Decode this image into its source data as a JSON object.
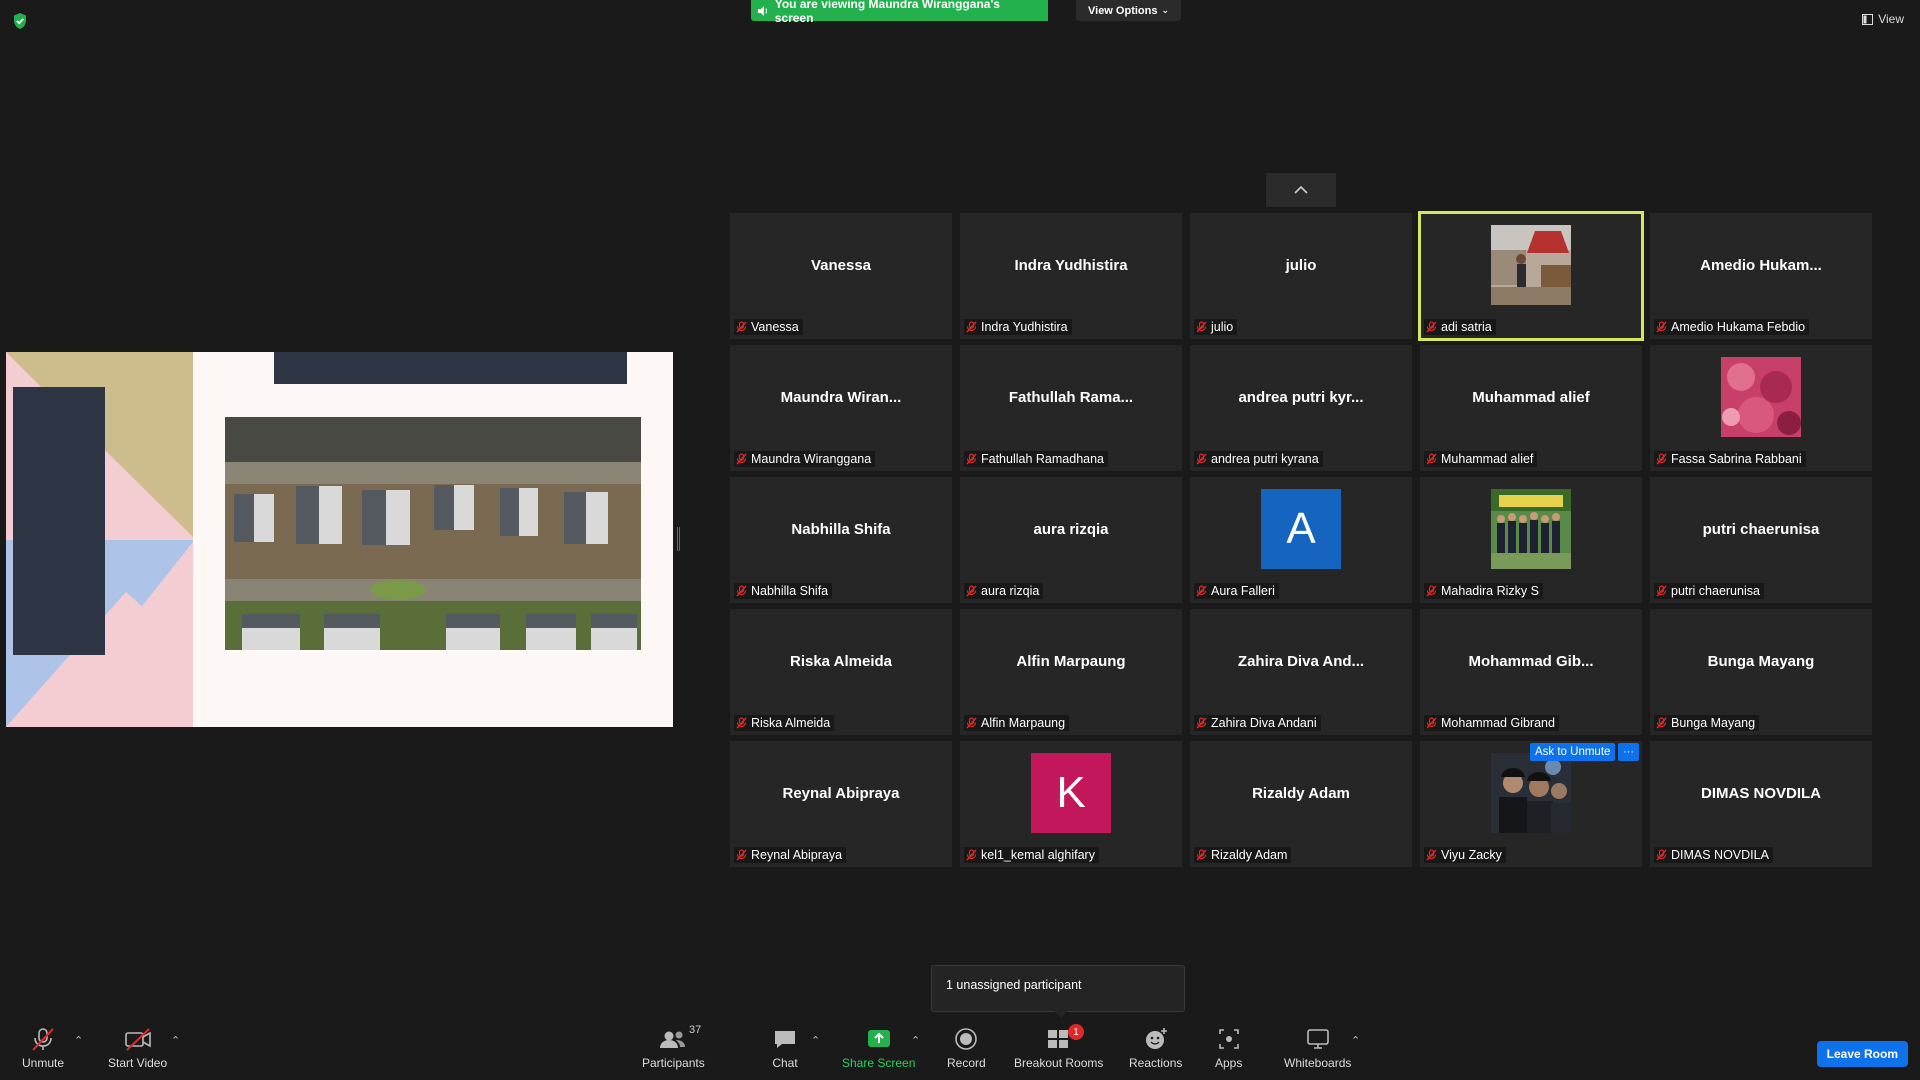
{
  "banner": {
    "viewing_text": "You are viewing Maundra Wiranggana's screen",
    "view_options": "View Options"
  },
  "top_right": {
    "view_label": "View"
  },
  "participants": [
    {
      "center": "Vanessa",
      "label": "Vanessa"
    },
    {
      "center": "Indra Yudhistira",
      "label": "Indra Yudhistira"
    },
    {
      "center": "julio",
      "label": "julio"
    },
    {
      "center": "",
      "label": "adi satria",
      "photo": "person-photo",
      "active": true
    },
    {
      "center": "Amedio  Hukam...",
      "label": "Amedio Hukama Febdio"
    },
    {
      "center": "Maundra  Wiran...",
      "label": "Maundra Wiranggana"
    },
    {
      "center": "Fathullah  Rama...",
      "label": "Fathullah Ramadhana"
    },
    {
      "center": "andrea  putri  kyr...",
      "label": "andrea putri kyrana"
    },
    {
      "center": "Muhammad alief",
      "label": "Muhammad alief"
    },
    {
      "center": "",
      "label": "Fassa Sabrina Rabbani",
      "photo": "flower-photo"
    },
    {
      "center": "Nabhilla Shifa",
      "label": "Nabhilla Shifa"
    },
    {
      "center": "aura rizqia",
      "label": "aura rizqia"
    },
    {
      "center": "",
      "label": "Aura Falleri",
      "letter": "A",
      "letter_color": "#1565c0"
    },
    {
      "center": "",
      "label": "Mahadira Rizky S",
      "photo": "group-photo"
    },
    {
      "center": "putri chaerunisa",
      "label": "putri chaerunisa"
    },
    {
      "center": "Riska Almeida",
      "label": "Riska Almeida"
    },
    {
      "center": "Alfin Marpaung",
      "label": "Alfin Marpaung"
    },
    {
      "center": "Zahira  Diva  And...",
      "label": "Zahira Diva Andani"
    },
    {
      "center": "Mohammad  Gib...",
      "label": "Mohammad Gibrand"
    },
    {
      "center": "Bunga Mayang",
      "label": "Bunga Mayang"
    },
    {
      "center": "Reynal Abipraya",
      "label": "Reynal Abipraya"
    },
    {
      "center": "",
      "label": "kel1_kemal alghifary",
      "letter": "K",
      "letter_color": "#c2185b"
    },
    {
      "center": "Rizaldy Adam",
      "label": "Rizaldy Adam"
    },
    {
      "center": "",
      "label": "Viyu Zacky",
      "photo": "friends-photo",
      "ask_unmute": "Ask to Unmute",
      "more": "···"
    },
    {
      "center": "DIMAS NOVDILA",
      "label": "DIMAS NOVDILA"
    }
  ],
  "tooltip": "1 unassigned participant",
  "toolbar": {
    "unmute": "Unmute",
    "start_video": "Start Video",
    "participants": "Participants",
    "participants_count": "37",
    "chat": "Chat",
    "share_screen": "Share Screen",
    "record": "Record",
    "breakout_rooms": "Breakout Rooms",
    "breakout_badge": "1",
    "reactions": "Reactions",
    "apps": "Apps",
    "whiteboards": "Whiteboards",
    "leave_room": "Leave Room"
  },
  "colors": {
    "banner_green": "#23b14d",
    "accent_blue": "#0e72ed",
    "active_speaker": "#d6e85a",
    "mic_muted_red": "#e02828"
  }
}
